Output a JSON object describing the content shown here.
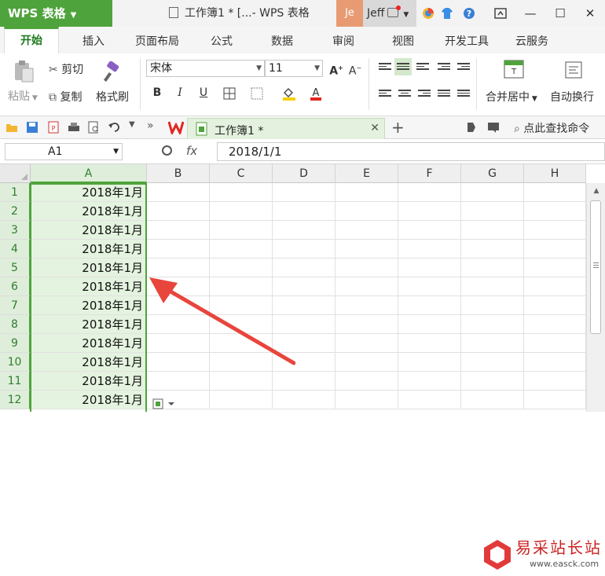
{
  "titlebar": {
    "app_name": "WPS 表格",
    "document_title": "工作簿1 * [...- WPS 表格",
    "user_avatar": "Je",
    "user_name": "Jeff"
  },
  "menu": {
    "tabs": [
      "开始",
      "插入",
      "页面布局",
      "公式",
      "数据",
      "审阅",
      "视图",
      "开发工具",
      "云服务"
    ]
  },
  "ribbon": {
    "paste": "粘贴",
    "cut": "剪切",
    "copy": "复制",
    "format_painter": "格式刷",
    "font_name": "宋体",
    "font_size": "11",
    "bold": "B",
    "italic": "I",
    "underline": "U",
    "merge_center": "合并居中",
    "wrap_text": "自动换行"
  },
  "quickbar": {
    "doc_tab": "工作簿1 *",
    "find_command": "点此查找命令"
  },
  "formula_bar": {
    "name_box": "A1",
    "fx": "fx",
    "value": "2018/1/1"
  },
  "sheet": {
    "columns": [
      "A",
      "B",
      "C",
      "D",
      "E",
      "F",
      "G",
      "H"
    ],
    "rows": [
      "1",
      "2",
      "3",
      "4",
      "5",
      "6",
      "7",
      "8",
      "9",
      "10",
      "11",
      "12"
    ],
    "a_values": [
      "2018年1月",
      "2018年1月",
      "2018年1月",
      "2018年1月",
      "2018年1月",
      "2018年1月",
      "2018年1月",
      "2018年1月",
      "2018年1月",
      "2018年1月",
      "2018年1月",
      "2018年1月"
    ]
  },
  "watermark": {
    "text": "易采站长站",
    "url": "www.easck.com"
  },
  "colors": {
    "accent": "#4fa33c",
    "selection_fill": "#e4f3df",
    "arrow": "#e8453c"
  }
}
